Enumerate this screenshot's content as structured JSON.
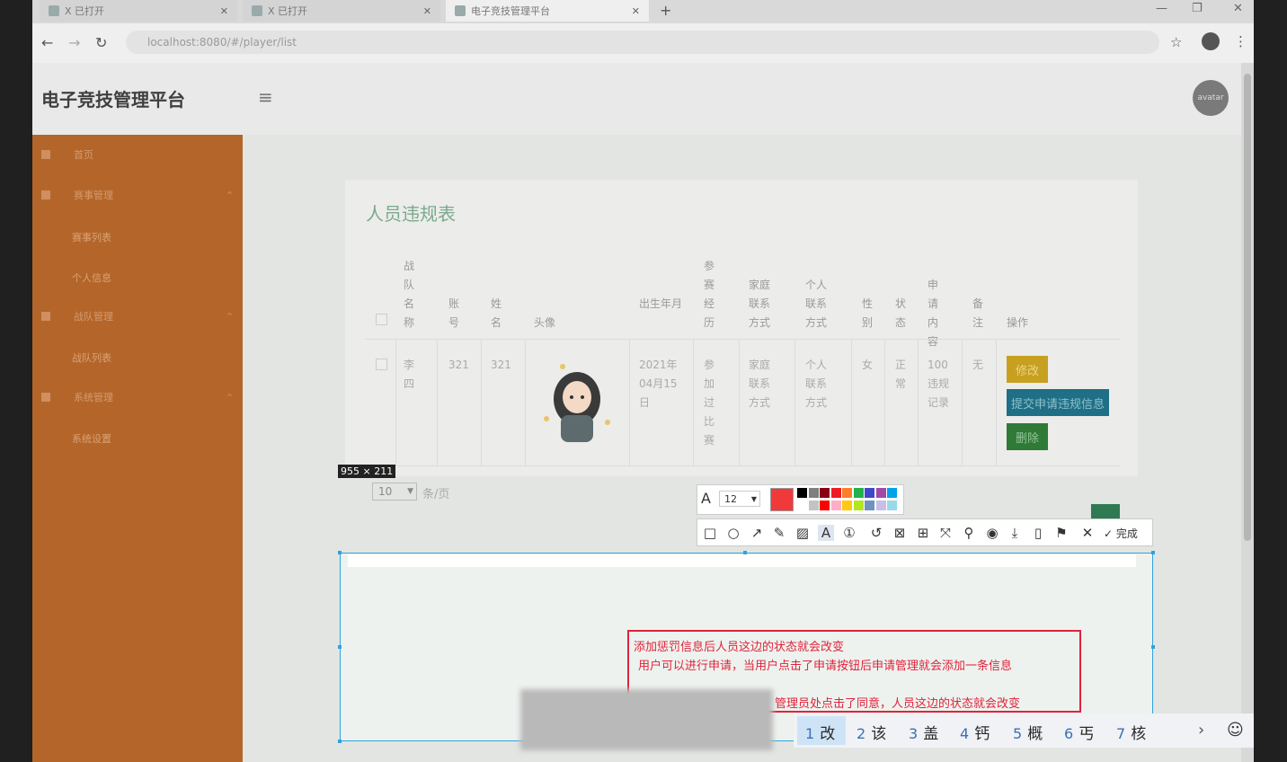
{
  "browser": {
    "tabs": [
      {
        "label": "X 已打开",
        "active": false
      },
      {
        "label": "X 已打开",
        "active": false
      },
      {
        "label": "电子竞技管理平台",
        "active": true
      }
    ],
    "new_tab": "+",
    "url": "localhost:8080/#/player/list",
    "window_controls": [
      "—",
      "❐",
      "✕"
    ]
  },
  "app": {
    "brand": "电子竞技管理平台",
    "avatar_text": "avatar"
  },
  "sidebar": {
    "items": [
      {
        "label": "首页",
        "subitems": []
      },
      {
        "label": "赛事管理",
        "subitems": [
          "赛事列表",
          "个人信息"
        ]
      },
      {
        "label": "战队管理",
        "subitems": [
          "战队列表"
        ]
      },
      {
        "label": "系统管理",
        "subitems": [
          "系统设置"
        ]
      }
    ]
  },
  "main": {
    "title": "人员违规表",
    "table": {
      "headers": [
        "战队名称",
        "账号",
        "姓名",
        "头像",
        "出生年月",
        "参赛经历",
        "家庭联系方式",
        "个人联系方式",
        "性别",
        "状态",
        "申请内容",
        "备注",
        "操作"
      ],
      "row": {
        "cells": [
          "李四",
          "321",
          "321",
          "",
          "2021年04月15日",
          "参加过比赛",
          "家庭联系方式",
          "个人联系方式",
          "女",
          "正常",
          "100违规记录",
          "无",
          ""
        ],
        "actions": [
          "修改",
          "提交申请违规信息",
          "删除"
        ]
      }
    },
    "pager": {
      "page_size": "10",
      "text": "条/页"
    }
  },
  "screenshot_tool": {
    "size_label": "955 × 211",
    "font_size": "12",
    "selected_color": "#f03a3a",
    "palette_top": [
      "#000000",
      "#7f7f7f",
      "#880015",
      "#ed1c24",
      "#ff7f27",
      "#22b14c",
      "#3f48cc",
      "#a349a4",
      "#00a2e8"
    ],
    "palette_bottom": [
      "#ffffff",
      "#c3c3c3",
      "#ff0000",
      "#ffaec9",
      "#ffc90e",
      "#b5e61d",
      "#7092be",
      "#c8bfe7",
      "#99d9ea"
    ],
    "tools": [
      "□",
      "○",
      "↗",
      "✎",
      "▨",
      "A",
      "①",
      "↺",
      "⊠",
      "⊞",
      "⤧",
      "⚲",
      "◉",
      "⤓",
      "▯",
      "⚑",
      "✕",
      "✓ 完成"
    ],
    "note_lines": [
      "添加惩罚信息后人员这边的状态就会改变",
      "用户可以进行申请，当用户点击了申请按钮后申请管理就会添加一条信息",
      "管理员处点击了同意，人员这边的状态就会改变"
    ]
  },
  "ime": {
    "candidates": [
      {
        "n": "1",
        "c": "改"
      },
      {
        "n": "2",
        "c": "该"
      },
      {
        "n": "3",
        "c": "盖"
      },
      {
        "n": "4",
        "c": "钙"
      },
      {
        "n": "5",
        "c": "概"
      },
      {
        "n": "6",
        "c": "丐"
      },
      {
        "n": "7",
        "c": "核"
      }
    ],
    "next": "›",
    "emoji": "☺"
  }
}
